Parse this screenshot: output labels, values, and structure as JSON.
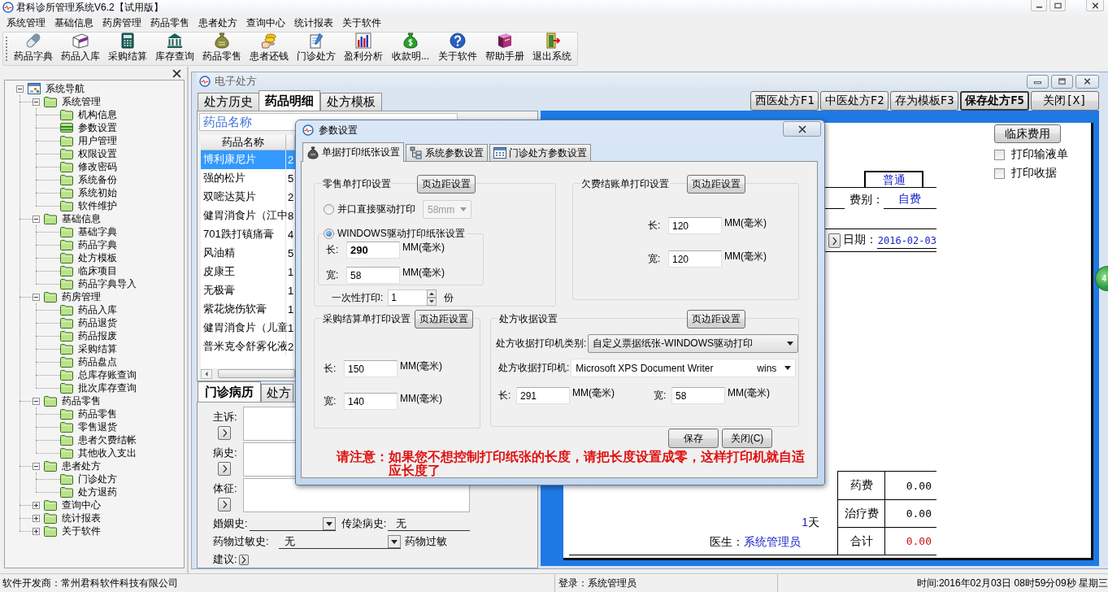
{
  "window": {
    "title": "君科诊所管理系统V6.2【试用版】"
  },
  "menu": [
    "系统管理",
    "基础信息",
    "药房管理",
    "药品零售",
    "患者处方",
    "查询中心",
    "统计报表",
    "关于软件"
  ],
  "toolbar": [
    "药品字典",
    "药品入库",
    "采购结算",
    "库存查询",
    "药品零售",
    "患者还钱",
    "门诊处方",
    "盈利分析",
    "收款明...",
    "关于软件",
    "帮助手册",
    "退出系统"
  ],
  "navigation": {
    "tree": [
      {
        "label": "系统导航",
        "expanded": true,
        "selected": false,
        "children": [
          {
            "label": "系统管理",
            "expanded": true,
            "selected": false,
            "children": [
              {
                "label": "机构信息",
                "selected": false
              },
              {
                "label": "参数设置",
                "selected": true
              },
              {
                "label": "用户管理",
                "selected": false
              },
              {
                "label": "权限设置",
                "selected": false
              },
              {
                "label": "修改密码",
                "selected": false
              },
              {
                "label": "系统备份",
                "selected": false
              },
              {
                "label": "系统初始",
                "selected": false
              },
              {
                "label": "软件维护",
                "selected": false
              }
            ]
          },
          {
            "label": "基础信息",
            "expanded": true,
            "selected": false,
            "children": [
              {
                "label": "基础字典",
                "selected": false
              },
              {
                "label": "药品字典",
                "selected": false
              },
              {
                "label": "处方模板",
                "selected": false
              },
              {
                "label": "临床项目",
                "selected": false
              },
              {
                "label": "药品字典导入",
                "selected": false
              }
            ]
          },
          {
            "label": "药房管理",
            "expanded": true,
            "selected": false,
            "children": [
              {
                "label": "药品入库",
                "selected": false
              },
              {
                "label": "药品退货",
                "selected": false
              },
              {
                "label": "药品报废",
                "selected": false
              },
              {
                "label": "采购结算",
                "selected": false
              },
              {
                "label": "药品盘点",
                "selected": false
              },
              {
                "label": "总库存账查询",
                "selected": false
              },
              {
                "label": "批次库存查询",
                "selected": false
              }
            ]
          },
          {
            "label": "药品零售",
            "expanded": true,
            "selected": false,
            "children": [
              {
                "label": "药品零售",
                "selected": false
              },
              {
                "label": "零售退货",
                "selected": false
              },
              {
                "label": "患者欠费结帐",
                "selected": false
              },
              {
                "label": "其他收入支出",
                "selected": false
              }
            ]
          },
          {
            "label": "患者处方",
            "expanded": true,
            "selected": false,
            "children": [
              {
                "label": "门诊处方",
                "selected": false
              },
              {
                "label": "处方退药",
                "selected": false
              }
            ]
          },
          {
            "label": "查询中心",
            "expanded": false,
            "selected": false
          },
          {
            "label": "统计报表",
            "expanded": false,
            "selected": false
          },
          {
            "label": "关于软件",
            "expanded": false,
            "selected": false
          }
        ]
      }
    ]
  },
  "prescription_window": {
    "title": "电子处方",
    "tabs": [
      {
        "label": "处方历史",
        "selected": false
      },
      {
        "label": "药品明细",
        "selected": true
      },
      {
        "label": "处方模板",
        "selected": false
      }
    ],
    "actions": [
      {
        "label": "西医处方F1",
        "default": false
      },
      {
        "label": "中医处方F2",
        "default": false
      },
      {
        "label": "存为模板F3",
        "default": false
      },
      {
        "label": "保存处方F5",
        "default": true
      },
      {
        "label": "关闭[X]",
        "default": false
      }
    ],
    "drug_search": {
      "placeholder": "药品名称"
    },
    "drug_table": {
      "columns": [
        "药品名称"
      ],
      "rows": [
        {
          "cells": [
            "博利康尼片",
            "2"
          ],
          "selected": true
        },
        {
          "cells": [
            "强的松片",
            "5"
          ],
          "selected": false
        },
        {
          "cells": [
            "双嘧达莫片",
            "2"
          ],
          "selected": false
        },
        {
          "cells": [
            "健胃消食片（江中",
            "8"
          ],
          "selected": false
        },
        {
          "cells": [
            "701跌打镇痛膏",
            "4"
          ],
          "selected": false
        },
        {
          "cells": [
            "风油精",
            "5"
          ],
          "selected": false
        },
        {
          "cells": [
            "皮康王",
            "1"
          ],
          "selected": false
        },
        {
          "cells": [
            "无极膏",
            "1"
          ],
          "selected": false
        },
        {
          "cells": [
            "紫花烧伤软膏",
            "1"
          ],
          "selected": false
        },
        {
          "cells": [
            "健胃消食片（儿童",
            "1"
          ],
          "selected": false
        },
        {
          "cells": [
            "普米克令舒雾化液",
            "2"
          ],
          "selected": false
        }
      ]
    },
    "record_tabs": [
      {
        "label": "门诊病历",
        "selected": true
      },
      {
        "label": "处方",
        "selected": false
      }
    ],
    "record": {
      "notes": [
        "主诉:",
        "病史:",
        "体征:"
      ],
      "marital_label": "婚姻史:",
      "infectious_label": "传染病史:",
      "infectious": "无",
      "allergy_label": "药物过敏史:",
      "allergy": "无",
      "allergy_2_label": "药物过敏",
      "advice_label": "建议:"
    },
    "receipt": {
      "category": "普通",
      "fee_type_label": "费别：",
      "fee_type": "自费",
      "date_label": "日期：",
      "date": "2016-02-03",
      "days": "1",
      "days_unit": "天",
      "doctor_label": "医生：",
      "doctor": "系统管理员",
      "fees": [
        {
          "label": "药费",
          "amount": "0.00",
          "total": false
        },
        {
          "label": "治疗费",
          "amount": "0.00",
          "total": false
        },
        {
          "label": "合计",
          "amount": "0.00",
          "total": true
        }
      ]
    },
    "clinical_fee_button": "临床费用",
    "print_options": [
      {
        "label": "打印输液单",
        "checked": false
      },
      {
        "label": "打印收据",
        "checked": false
      }
    ]
  },
  "floating_badge": "4",
  "settings_dialog": {
    "title": "参数设置",
    "tabs": [
      {
        "label": "单据打印纸张设置",
        "selected": true
      },
      {
        "label": "系统参数设置",
        "selected": false
      },
      {
        "label": "门诊处方参数设置",
        "selected": false
      }
    ],
    "retail": {
      "title": "零售单打印设置",
      "margin_button": "页边距设置",
      "modes": [
        {
          "label": "并口直接驱动打印",
          "selected": false
        },
        {
          "label": "WINDOWS驱动打印纸张设置",
          "selected": true
        }
      ],
      "paper": {
        "value": "58mm",
        "disabled": true
      },
      "size": [
        {
          "label": "长:",
          "value": "290",
          "unit": "MM(毫米)",
          "emphasized": true
        },
        {
          "label": "宽:",
          "value": "58",
          "unit": "MM(毫米)",
          "emphasized": false
        }
      ],
      "copies_label": "一次性打印:",
      "copies": "1",
      "copies_unit": "份"
    },
    "arrears": {
      "title": "欠费结账单打印设置",
      "margin_button": "页边距设置",
      "size": [
        {
          "label": "长:",
          "value": "120",
          "unit": "MM(毫米)"
        },
        {
          "label": "宽:",
          "value": "120",
          "unit": "MM(毫米)"
        }
      ]
    },
    "purchase": {
      "title": "采购结算单打印设置",
      "margin_button": "页边距设置",
      "size": [
        {
          "label": "长:",
          "value": "150",
          "unit": "MM(毫米)"
        },
        {
          "label": "宽:",
          "value": "140",
          "unit": "MM(毫米)"
        }
      ]
    },
    "receipt": {
      "title": "处方收据设置",
      "margin_button": "页边距设置",
      "printer_type_label": "处方收据打印机类别:",
      "printer_type": "自定义票据纸张-WINDOWS驱动打印",
      "printer_label": "处方收据打印机:",
      "printer": "Microsoft XPS Document Writer",
      "printer_suffix": "wins",
      "size": [
        {
          "label": "长:",
          "value": "291",
          "unit": "MM(毫米)"
        },
        {
          "label": "宽:",
          "value": "58",
          "unit": "MM(毫米)"
        }
      ]
    },
    "buttons": [
      "保存",
      "关闭(C)"
    ],
    "note": "请注意：如果您不想控制打印纸张的长度，请把长度设置成零，这样打印机就自适应长度了"
  },
  "status_bar": [
    "软件开发商：常州君科软件科技有限公司",
    "登录：系统管理员",
    "时间:2016年02月03日 08时59分09秒 星期三"
  ]
}
